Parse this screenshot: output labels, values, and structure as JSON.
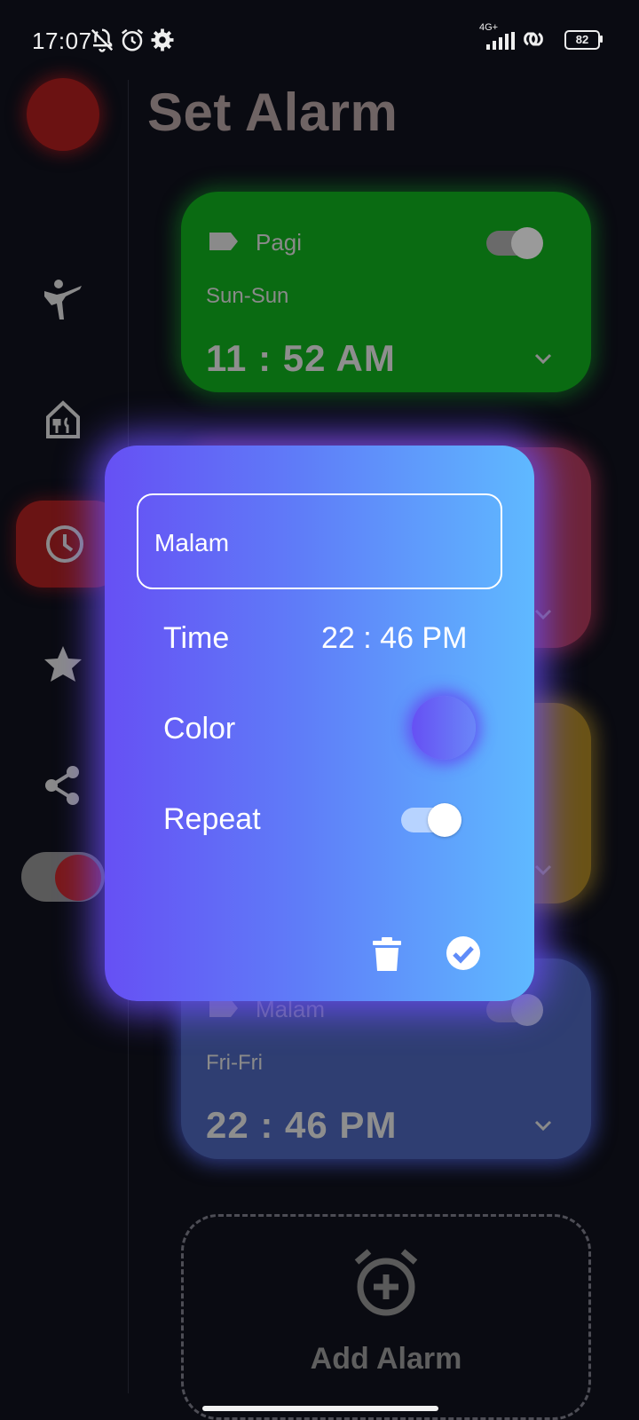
{
  "status_bar": {
    "time": "17:07",
    "network": "4G+",
    "battery": "82"
  },
  "page": {
    "title": "Set Alarm"
  },
  "sidebar": {
    "items": [
      {
        "icon": "martial-arts-icon"
      },
      {
        "icon": "restaurant-icon"
      },
      {
        "icon": "clock-icon",
        "active": true
      },
      {
        "icon": "star-icon"
      },
      {
        "icon": "share-icon"
      }
    ],
    "theme_toggle": "on"
  },
  "alarms": [
    {
      "label": "Pagi",
      "days": "Sun-Sun",
      "time": "11 : 52 AM",
      "color": "#0a6b12"
    },
    {
      "label": "",
      "days": "",
      "time": "",
      "color": "#6e2438"
    },
    {
      "label": "",
      "days": "",
      "time": "",
      "color": "#6a5316"
    },
    {
      "label": "Malam",
      "days": "Fri-Fri",
      "time": "22 : 46 PM",
      "color": "#2f3e72"
    }
  ],
  "add_alarm": {
    "label": "Add Alarm"
  },
  "dialog": {
    "name_value": "Malam",
    "time_label": "Time",
    "time_value": "22 : 46 PM",
    "color_label": "Color",
    "repeat_label": "Repeat",
    "repeat_enabled": true,
    "gradient": [
      "#6650f4",
      "#5fb9ff"
    ]
  }
}
